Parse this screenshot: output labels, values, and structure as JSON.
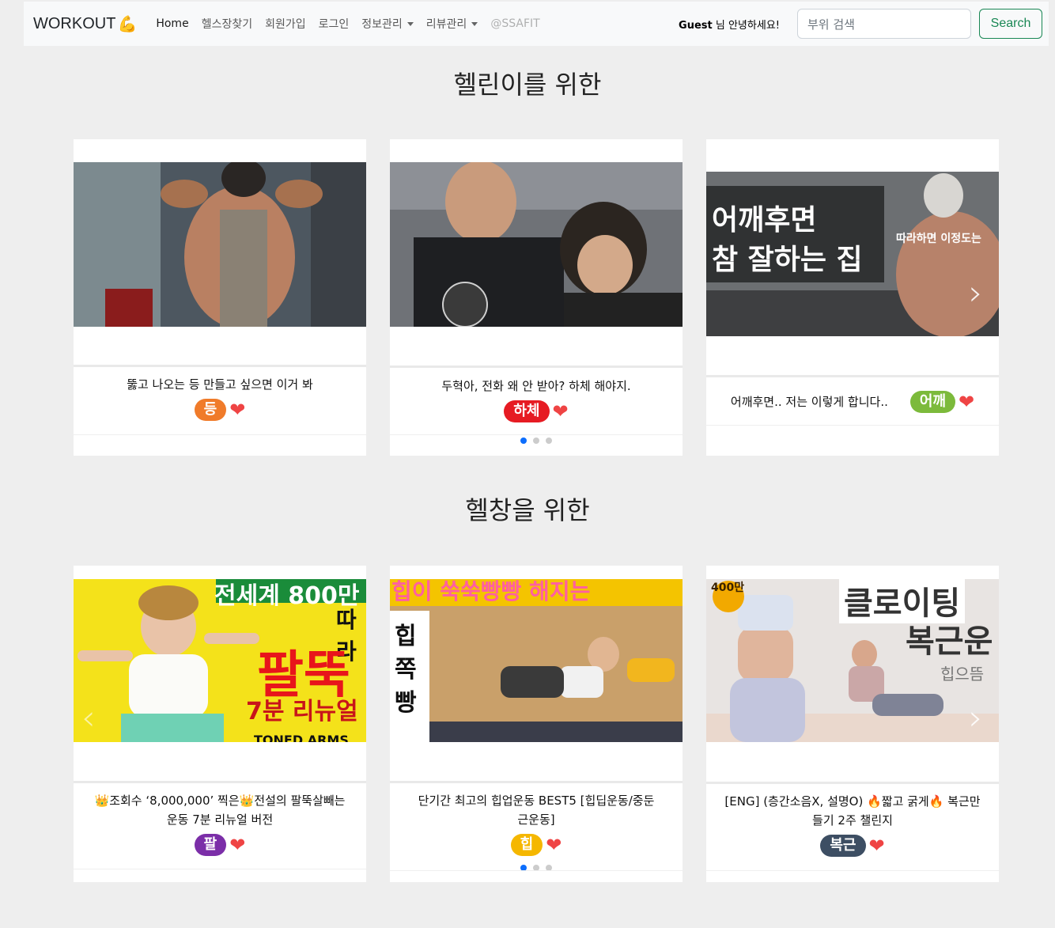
{
  "navbar": {
    "brand": "WORKOUT",
    "brand_icon": "💪",
    "links": [
      "Home",
      "헬스장찾기",
      "회원가입",
      "로그인",
      "정보관리",
      "리뷰관리",
      "@SSAFIT"
    ],
    "greeting_name": "Guest",
    "greeting_text": " 님 안녕하세요!",
    "search_placeholder": "부위 검색",
    "search_button": "Search"
  },
  "sections": [
    {
      "title": "헬린이를 위한",
      "cards": [
        {
          "title": "뚫고 나오는 등 만들고 싶으면 이거 봐",
          "tag": "등",
          "tag_color": "#f07b2a"
        },
        {
          "title": "두혁아, 전화 왜 안 받아? 하체 해야지.",
          "tag": "하체",
          "tag_color": "#e61b23"
        },
        {
          "title": "어깨후면.. 저는 이렇게 합니다..",
          "tag": "어깨",
          "tag_color": "#7cba3b",
          "overlay_line1": "어깨후면",
          "overlay_line2": "참 잘하는 집",
          "overlay_side": "따라하면 이정도는"
        }
      ]
    },
    {
      "title": "헬창을 위한",
      "cards": [
        {
          "title_line1": "👑조회수 ‘8,000,000’ 찍은👑전설의 팔뚝살빼는",
          "title_line2": "운동 7분 리뉴얼 버전",
          "tag": "팔",
          "tag_color": "#7b2ea8",
          "overlay_top": "전세계 800만",
          "overlay_mid": "따라",
          "overlay_big": "팔뚝",
          "overlay_sub": "7분 리뉴얼",
          "overlay_bottom": "TONED ARMS WO"
        },
        {
          "title_line1": "단기간 최고의 힙업운동 BEST5 [힙딥운동/중둔",
          "title_line2": "근운동]",
          "tag": "힙",
          "tag_color": "#f5b700",
          "overlay_top": "힙이 쑥쑥빵빵 해지는",
          "overlay_side": "힙쪽빵"
        },
        {
          "title_line1": "[ENG] (층간소음X, 설명O) 🔥짧고 굵게🔥 복근만",
          "title_line2": "들기 2주 챌린지",
          "tag": "복근",
          "tag_color": "#3d4e63",
          "overlay_badge": "400만",
          "overlay_line1": "클로이팅",
          "overlay_line2": "복근운",
          "overlay_sign": "힙으뜸"
        }
      ]
    }
  ]
}
